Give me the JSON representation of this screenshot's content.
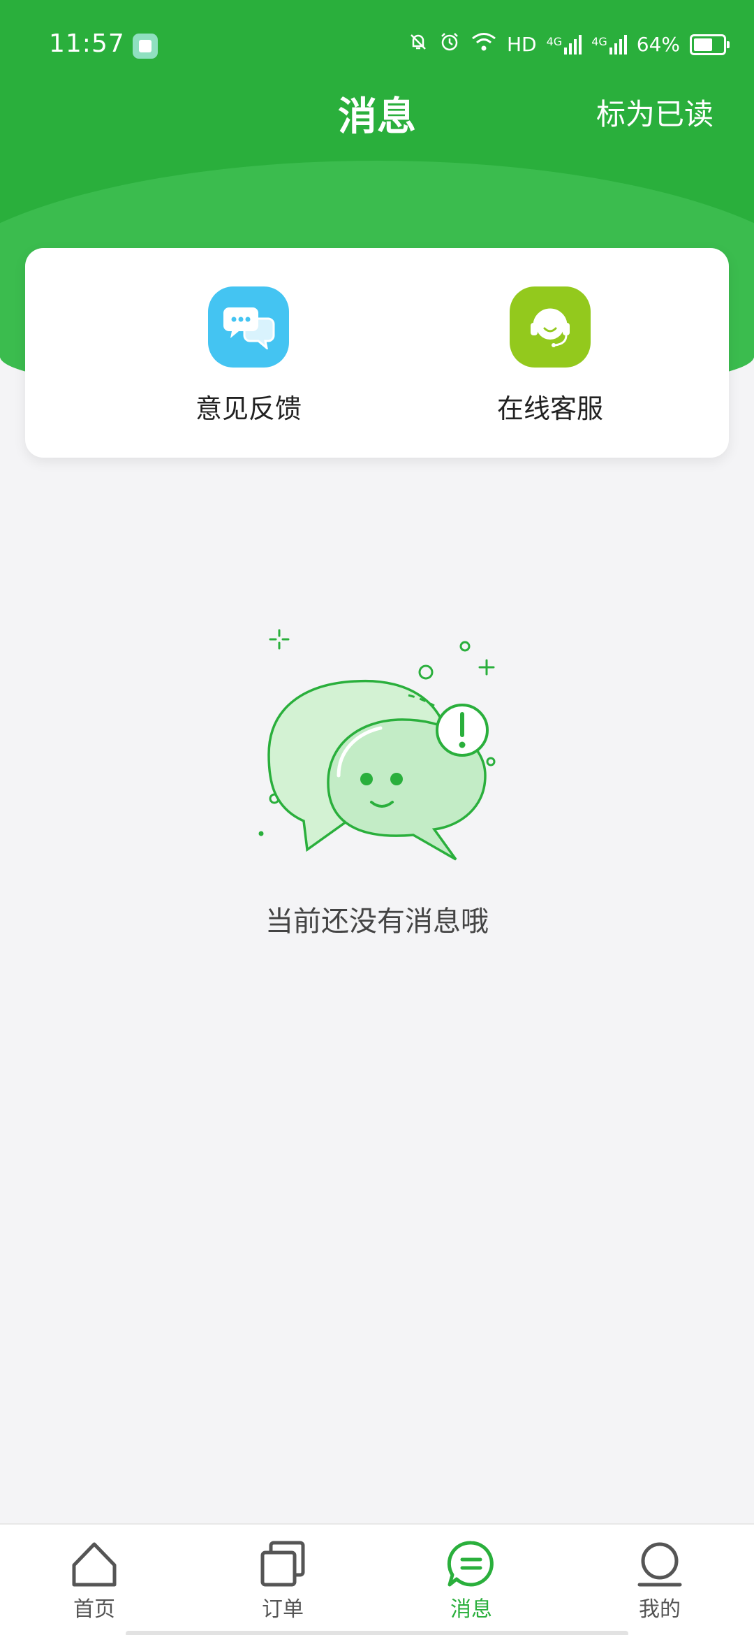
{
  "status_bar": {
    "time": "11:57",
    "network_label": "HD",
    "cell1_label": "4G",
    "cell2_label": "4G",
    "battery_percent": "64%"
  },
  "header": {
    "title": "消息",
    "mark_read_label": "标为已读"
  },
  "shortcuts": {
    "feedback_label": "意见反馈",
    "service_label": "在线客服"
  },
  "empty_state": {
    "text": "当前还没有消息哦"
  },
  "bottom_nav": {
    "items": [
      {
        "label": "首页",
        "icon": "home-icon"
      },
      {
        "label": "订单",
        "icon": "orders-icon"
      },
      {
        "label": "消息",
        "icon": "message-icon",
        "active": true
      },
      {
        "label": "我的",
        "icon": "profile-icon"
      }
    ]
  },
  "colors": {
    "brand_green": "#2aaf3c",
    "feedback_blue": "#44c4f2",
    "service_lime": "#93c91d"
  }
}
